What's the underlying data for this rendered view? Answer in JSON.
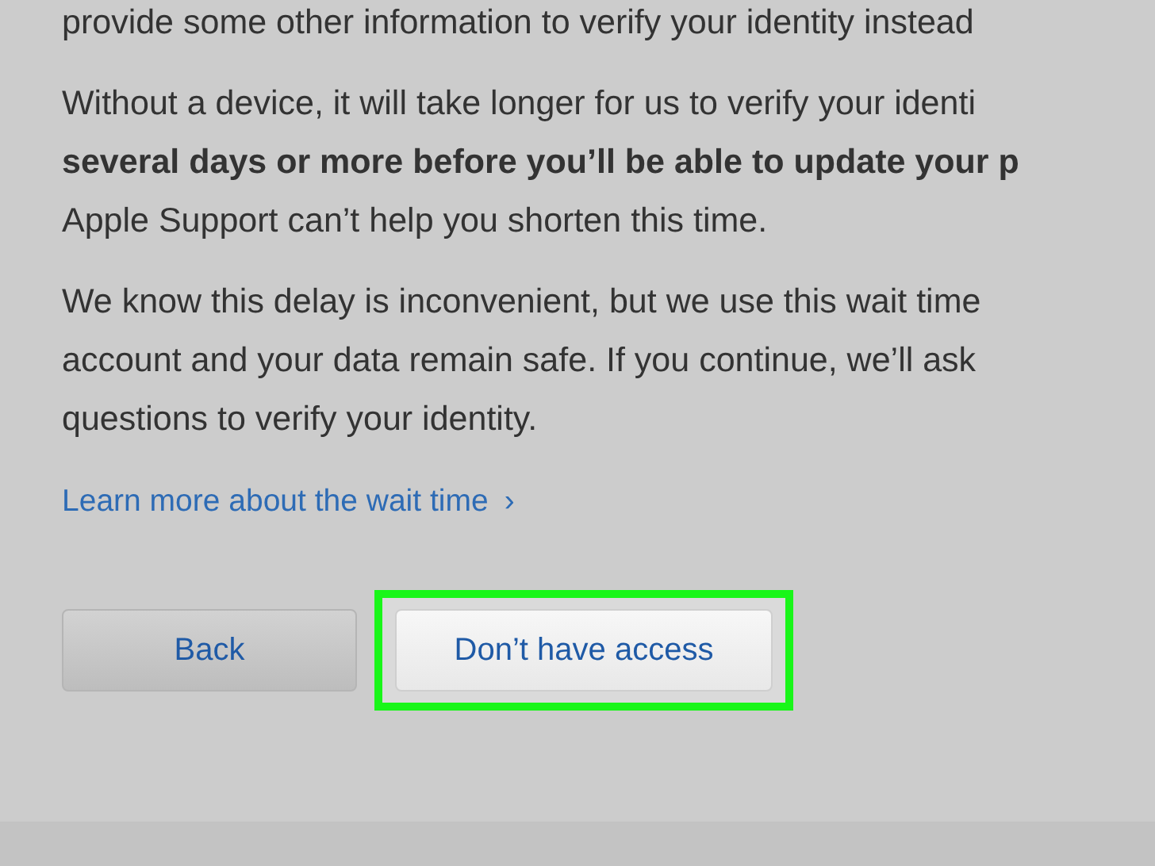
{
  "paragraphs": [
    {
      "lines": [
        {
          "text": "provide some other information to verify your identity instead",
          "bold": false
        }
      ]
    },
    {
      "lines": [
        {
          "text": "Without a device, it will take longer for us to verify your identi",
          "bold": false
        },
        {
          "text": "several days or more before you’ll be able to update your p",
          "bold": true
        },
        {
          "text": "Apple Support can’t help you shorten this time.",
          "bold": false
        }
      ]
    },
    {
      "lines": [
        {
          "text": "We know this delay is inconvenient, but we use this wait time",
          "bold": false
        },
        {
          "text": "account and your data remain safe. If you continue, we’ll ask",
          "bold": false
        },
        {
          "text": "questions to verify your identity.",
          "bold": false
        }
      ]
    }
  ],
  "link": {
    "label": "Learn more about the wait time",
    "chevron": "›"
  },
  "buttons": [
    {
      "label": "Back",
      "kind": "secondary",
      "highlighted": false
    },
    {
      "label": "Don’t have access",
      "kind": "primary",
      "highlighted": true
    }
  ]
}
